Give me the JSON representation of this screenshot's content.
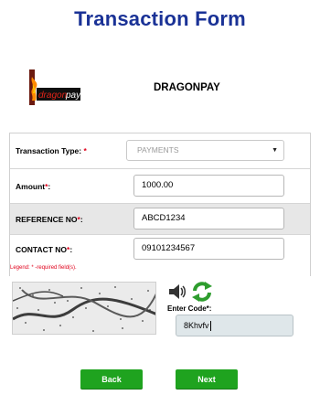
{
  "page": {
    "title": "Transaction Form"
  },
  "merchant": {
    "logo_text": "dragonpay",
    "name": "DRAGONPAY"
  },
  "form": {
    "transaction_type": {
      "label": "Transaction Type:",
      "required_mark": " *",
      "value": "PAYMENTS"
    },
    "amount": {
      "label": "Amount",
      "required_mark": "*",
      "colon": ":",
      "value": "1000.00"
    },
    "reference": {
      "label": "REFERENCE NO",
      "required_mark": "*",
      "colon": ":",
      "value": "ABCD1234"
    },
    "contact": {
      "label": "CONTACT NO",
      "required_mark": "*",
      "colon": ":",
      "value": "09101234567"
    }
  },
  "legend": "Legend: * -required field(s).",
  "captcha": {
    "image_text": "8Khvfv",
    "enter_code_label": "Enter Code*:",
    "entered_value": "8Khvfv"
  },
  "buttons": {
    "back": "Back",
    "next": "Next"
  },
  "colors": {
    "title": "#1a3296",
    "required": "#e0001b",
    "button": "#1fa31f",
    "alt_row": "#e7e7e7"
  }
}
